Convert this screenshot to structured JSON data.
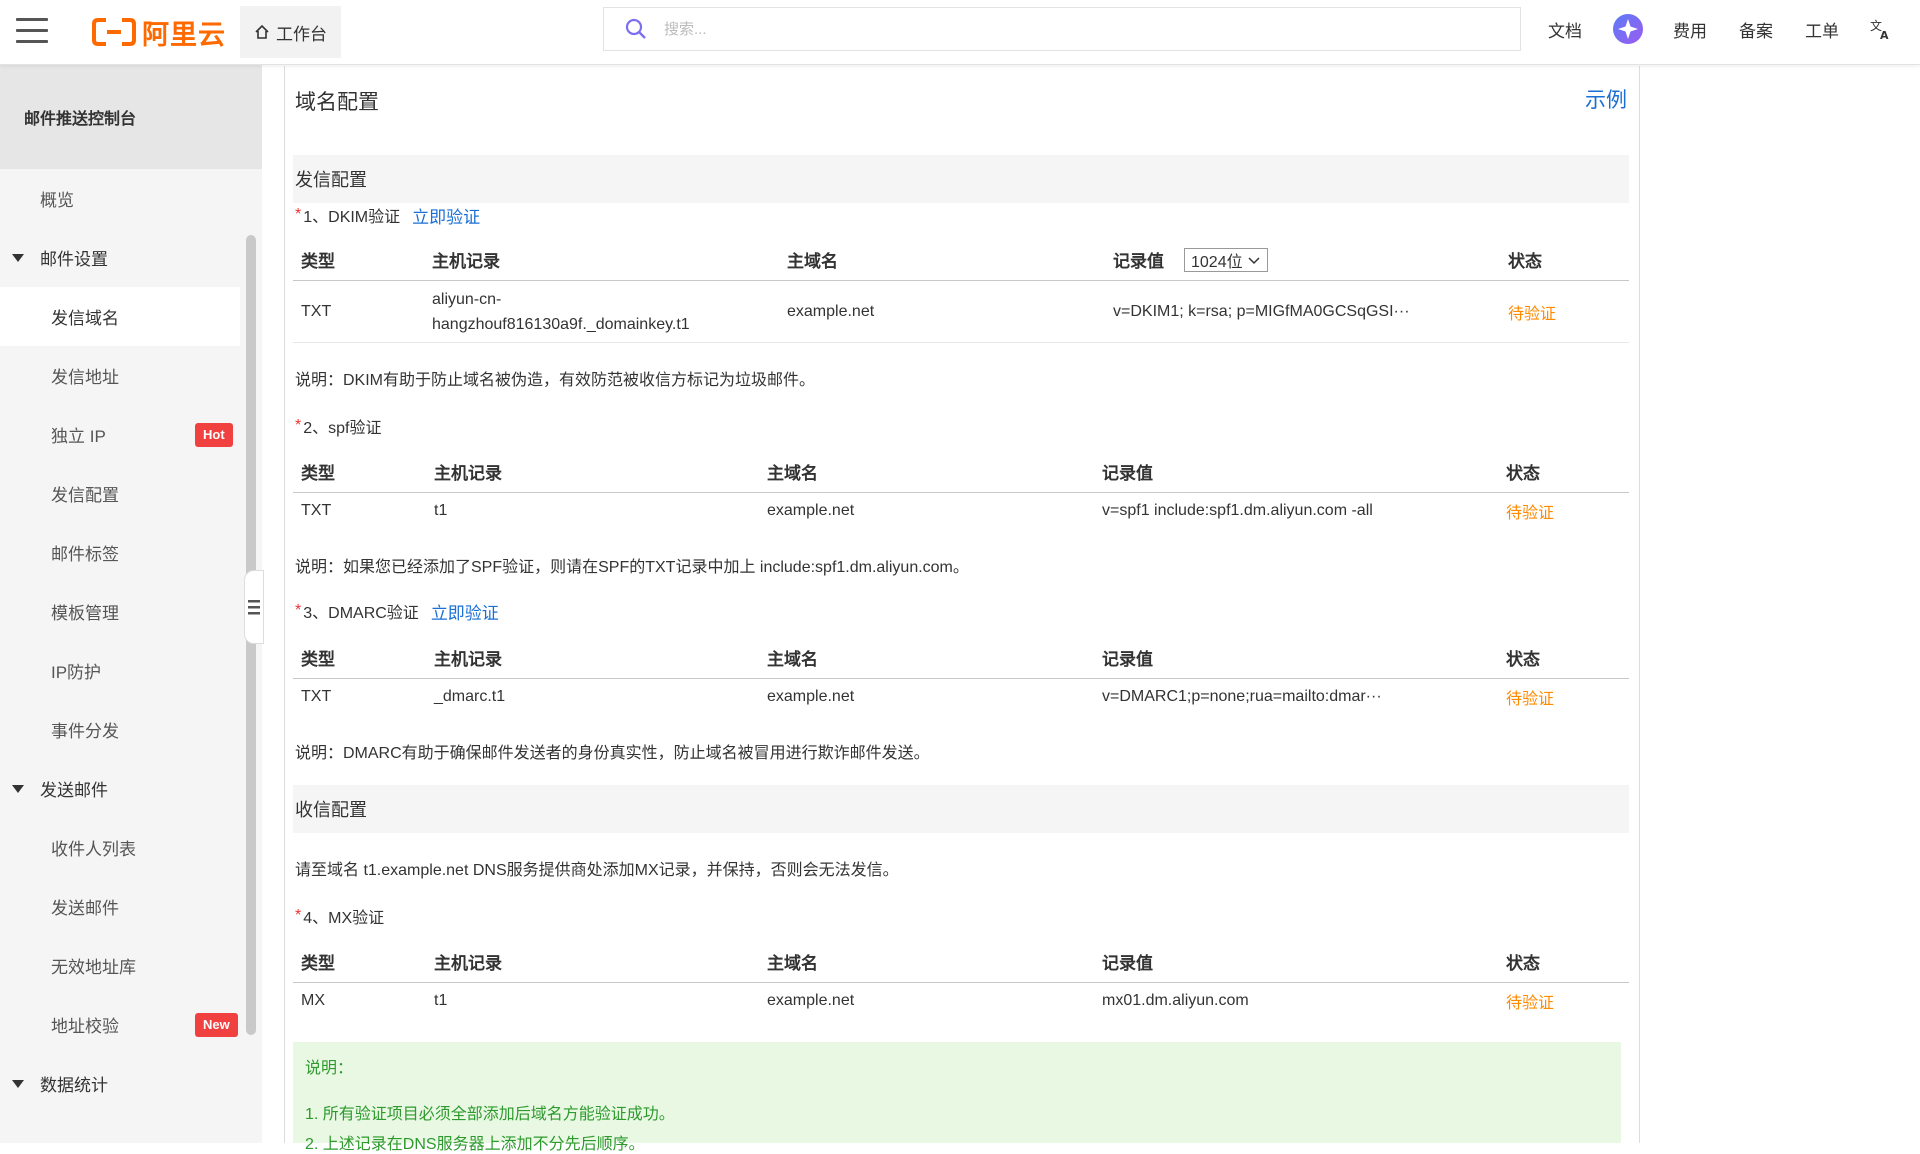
{
  "topbar": {
    "logo_text": "阿里云",
    "workbench_label": "工作台",
    "search_placeholder": "搜索...",
    "nav": {
      "docs": "文档",
      "billing": "费用",
      "icp": "备案",
      "ticket": "工单"
    },
    "colors": {
      "brand": "#ff6a00",
      "accent": "#1a6fd6"
    }
  },
  "sidebar": {
    "title": "邮件推送控制台",
    "items": [
      {
        "label": "概览"
      },
      {
        "label": "邮件设置"
      },
      {
        "label": "发信域名"
      },
      {
        "label": "发信地址"
      },
      {
        "label": "独立 IP",
        "badge": "Hot"
      },
      {
        "label": "发信配置"
      },
      {
        "label": "邮件标签"
      },
      {
        "label": "模板管理"
      },
      {
        "label": "IP防护"
      },
      {
        "label": "事件分发"
      },
      {
        "label": "发送邮件"
      },
      {
        "label": "收件人列表"
      },
      {
        "label": "发送邮件"
      },
      {
        "label": "无效地址库"
      },
      {
        "label": "地址校验",
        "badge": "New"
      },
      {
        "label": "数据统计"
      }
    ]
  },
  "main": {
    "title": "域名配置",
    "example_link": "示例",
    "send_section": "发信配置",
    "receive_section": "收信配置",
    "columns": {
      "type": "类型",
      "host": "主机记录",
      "domain": "主域名",
      "value": "记录值",
      "status": "状态"
    },
    "dkim": {
      "label": "1、DKIM验证",
      "verify_link": "立即验证",
      "key_length": "1024位",
      "row": {
        "type": "TXT",
        "host_line1": "aliyun-cn-",
        "host_line2": "hangzhouf816130a9f._domainkey.t1",
        "domain": "example.net",
        "value": "v=DKIM1; k=rsa; p=MIGfMA0GCSqGSI···",
        "status": "待验证"
      },
      "note": "说明：DKIM有助于防止域名被伪造，有效防范被收信方标记为垃圾邮件。"
    },
    "spf": {
      "label": "2、spf验证",
      "row": {
        "type": "TXT",
        "host": "t1",
        "domain": "example.net",
        "value": "v=spf1 include:spf1.dm.aliyun.com -all",
        "status": "待验证"
      },
      "note": "说明：如果您已经添加了SPF验证，则请在SPF的TXT记录中加上 include:spf1.dm.aliyun.com。"
    },
    "dmarc": {
      "label": "3、DMARC验证",
      "verify_link": "立即验证",
      "row": {
        "type": "TXT",
        "host": "_dmarc.t1",
        "domain": "example.net",
        "value": "v=DMARC1;p=none;rua=mailto:dmar···",
        "status": "待验证"
      },
      "note": "说明：DMARC有助于确保邮件发送者的身份真实性，防止域名被冒用进行欺诈邮件发送。"
    },
    "receive_note": "请至域名 t1.example.net DNS服务提供商处添加MX记录，并保持，否则会无法发信。",
    "mx": {
      "label": "4、MX验证",
      "row": {
        "type": "MX",
        "host": "t1",
        "domain": "example.net",
        "value": "mx01.dm.aliyun.com",
        "status": "待验证"
      }
    },
    "tip": {
      "title": "说明：",
      "line1": "1. 所有验证项目必须全部添加后域名方能验证成功。",
      "line2": "2. 上述记录在DNS服务器上添加不分先后顺序。"
    }
  }
}
